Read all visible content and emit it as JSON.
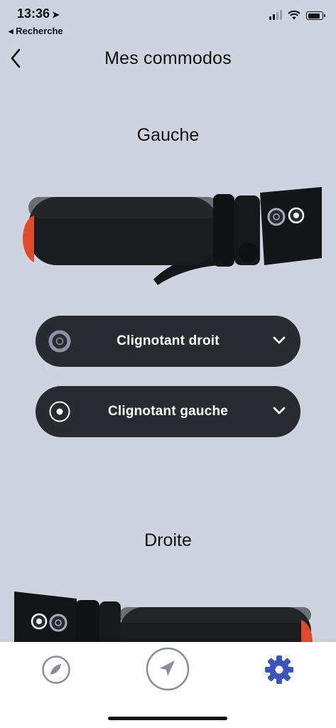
{
  "status_bar": {
    "time": "13:36",
    "back_app": "◂ Recherche"
  },
  "header": {
    "title": "Mes commodos"
  },
  "sections": [
    {
      "title": "Gauche",
      "buttons": [
        {
          "label": "Clignotant droit",
          "icon": "ring-button-icon"
        },
        {
          "label": "Clignotant gauche",
          "icon": "dot-button-icon"
        }
      ]
    },
    {
      "title": "Droite"
    }
  ],
  "tab_bar": {
    "tabs": [
      {
        "icon": "compass-icon",
        "active": false
      },
      {
        "icon": "navigation-arrow-icon",
        "active": false
      },
      {
        "icon": "gear-icon",
        "active": true
      }
    ],
    "active_color": "#3d55b8",
    "inactive_color": "#8a8d99"
  },
  "colors": {
    "background": "#cfd3e0",
    "pill": "#2a2b30",
    "grip_accent": "#e24a2c"
  }
}
